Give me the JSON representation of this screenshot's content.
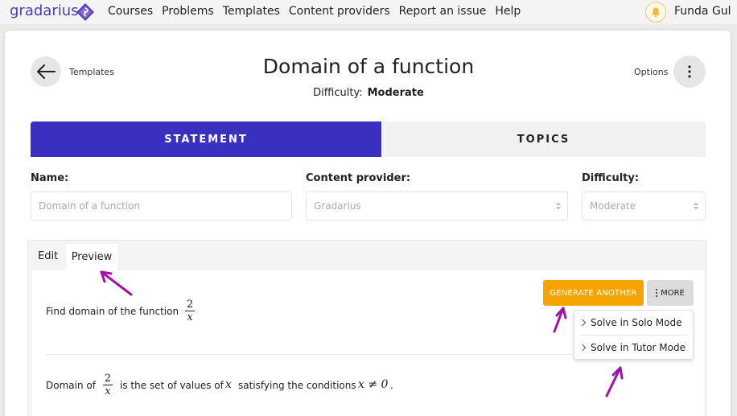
{
  "nav": {
    "brand": "gradarius",
    "items": [
      "Courses",
      "Problems",
      "Templates",
      "Content providers",
      "Report an issue",
      "Help"
    ],
    "user_name": "Funda Gul"
  },
  "header": {
    "back_label": "Templates",
    "title": "Domain of a function",
    "difficulty_label": "Difficulty:",
    "difficulty_value": "Moderate",
    "options_label": "Options"
  },
  "tabs": {
    "statement": "STATEMENT",
    "topics": "TOPICS"
  },
  "form": {
    "name_label": "Name:",
    "name_placeholder": "Domain of a function",
    "provider_label": "Content provider:",
    "provider_value": "Gradarius",
    "difficulty_label": "Difficulty:",
    "difficulty_value": "Moderate"
  },
  "editor": {
    "edit_tab": "Edit",
    "preview_tab": "Preview"
  },
  "preview": {
    "problem_text": "Find domain of the function",
    "frac_num": "2",
    "frac_den": "x",
    "generate_button": "GENERATE ANOTHER",
    "more_button": "MORE",
    "menu": [
      "Solve in Solo Mode",
      "Solve in Tutor Mode"
    ],
    "solution_prefix": "Domain of",
    "solution_middle": "is the set of values of",
    "solution_var": "x",
    "solution_suffix": "satisfying the conditions",
    "solution_condition": "x ≠ 0",
    "solution_end": "."
  },
  "colors": {
    "brand": "#4a3dc4",
    "active_tab": "#3a30c0",
    "generate_button": "#f5a300",
    "annotation_arrow": "#a012a8"
  }
}
